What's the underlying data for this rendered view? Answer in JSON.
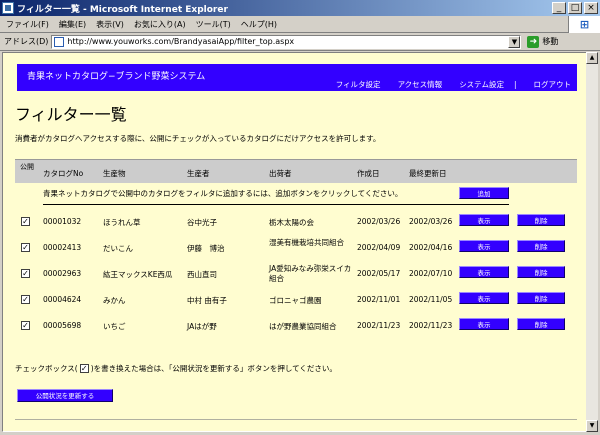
{
  "window": {
    "title": "フィルター一覧 - Microsoft Internet Explorer",
    "buttons": [
      "_",
      "□",
      "×"
    ]
  },
  "menu": [
    "ファイル(F)",
    "編集(E)",
    "表示(V)",
    "お気に入り(A)",
    "ツール(T)",
    "ヘルプ(H)"
  ],
  "address": {
    "label": "アドレス(D)",
    "url": "http://www.youworks.com/BrandyasaiApp/filter_top.aspx",
    "go_label": "移動"
  },
  "site": {
    "title": "青果ネットカタログ−ブランド野菜システム",
    "nav": [
      "フィルタ設定",
      "アクセス情報",
      "システム設定",
      "ログアウト"
    ],
    "nav_sep": "|"
  },
  "page": {
    "title": "フィルター一覧",
    "description": "消費者がカタログへアクセスする際に、公開にチェックが入っているカタログにだけアクセスを許可します。"
  },
  "table": {
    "headers": {
      "public": "公開",
      "catalog_no": "カタログNo",
      "product": "生産物",
      "producer": "生産者",
      "shipper": "出荷者",
      "created": "作成日",
      "updated": "最終更新日"
    },
    "add_message": "青果ネットカタログで公開中のカタログをフィルタに追加するには、追加ボタンをクリックしてください。",
    "add_button": "追加",
    "view_button": "表示",
    "delete_button": "削除",
    "rows": [
      {
        "checked": "✓",
        "catalog_no": "00001032",
        "product": "ほうれん草",
        "producer": "谷中光子",
        "shipper": "栃木太陽の会",
        "created": "2002/03/26",
        "updated": "2002/03/26"
      },
      {
        "checked": "✓",
        "catalog_no": "00002413",
        "product": "だいこん",
        "producer": "伊藤　博治",
        "shipper": "湿美有機栽培共同組合",
        "created": "2002/04/09",
        "updated": "2002/04/16"
      },
      {
        "checked": "✓",
        "catalog_no": "00002963",
        "product": "紘王マックスKE西瓜",
        "producer": "西山直司",
        "shipper": "JA愛知みなみ弥栄スイカ組合",
        "created": "2002/05/17",
        "updated": "2002/07/10"
      },
      {
        "checked": "✓",
        "catalog_no": "00004624",
        "product": "みかん",
        "producer": "中村 由有子",
        "shipper": "ゴロニャゴ農園",
        "created": "2002/11/01",
        "updated": "2002/11/05"
      },
      {
        "checked": "✓",
        "catalog_no": "00005698",
        "product": "いちご",
        "producer": "JAはが野",
        "shipper": "はが野農業協同組合",
        "created": "2002/11/23",
        "updated": "2002/11/23"
      }
    ]
  },
  "footer": {
    "note_before": "チェックボックス(",
    "note_check": "✓",
    "note_after": ")を書き換えた場合は、「公開状況を更新する」ボタンを押してください。",
    "update_button": "公開状況を更新する"
  },
  "scrollbar": {
    "up": "▲",
    "down": "▼"
  }
}
